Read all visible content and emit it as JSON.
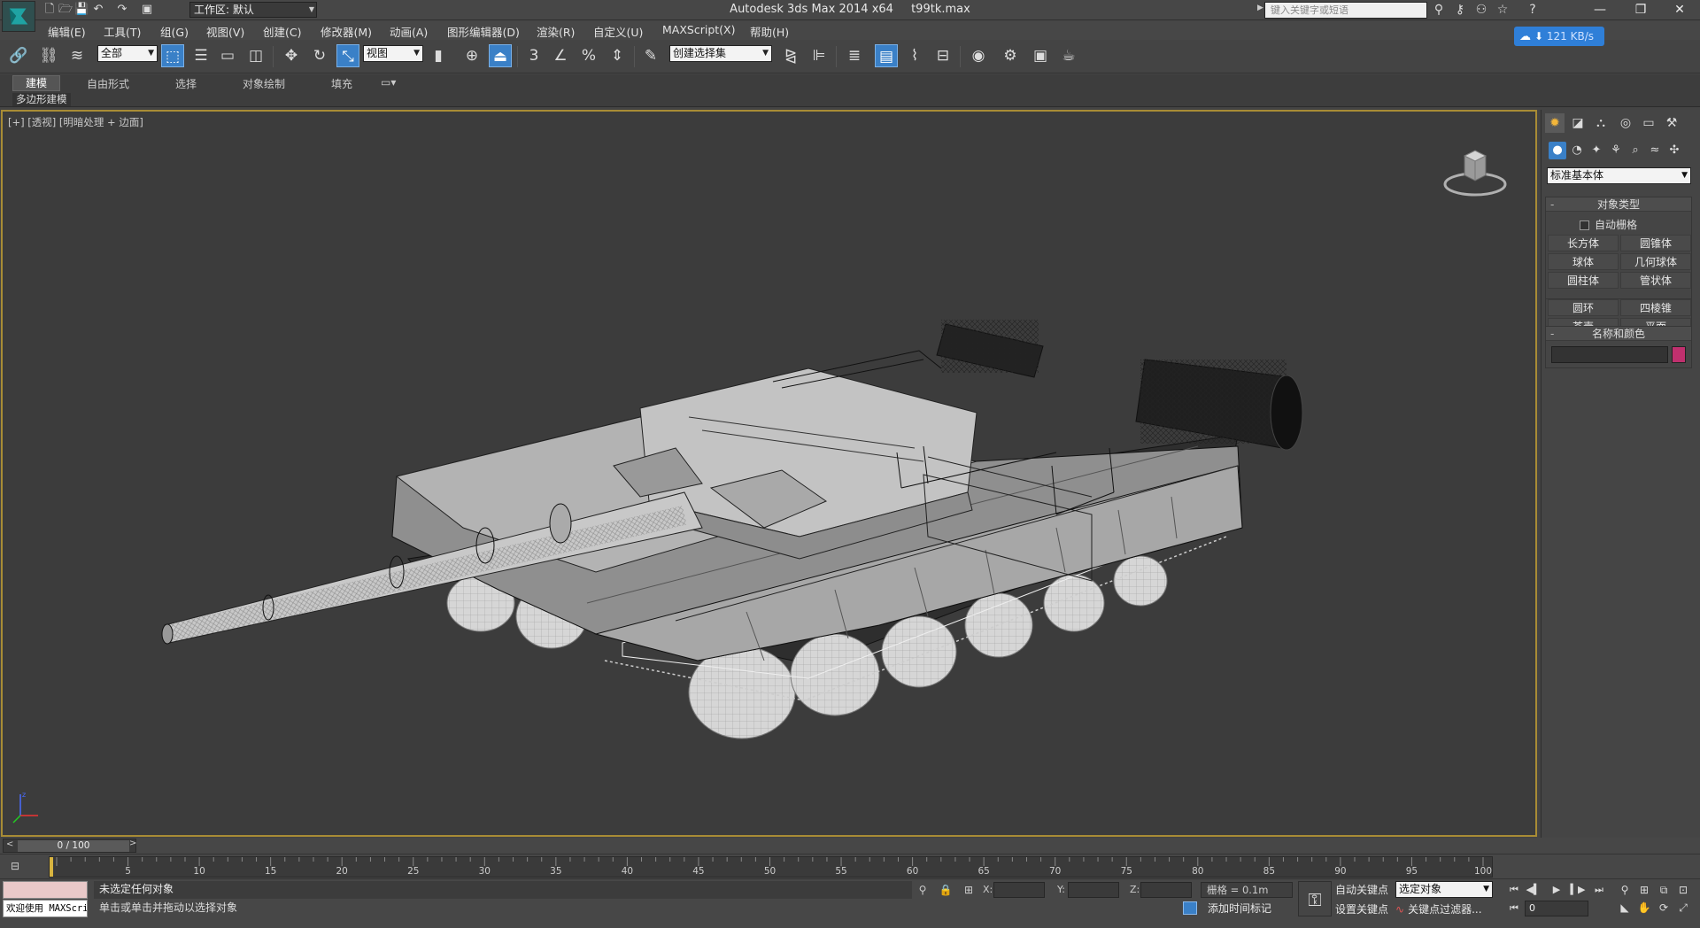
{
  "window": {
    "title_app": "Autodesk 3ds Max  2014 x64",
    "title_file": "t99tk.max",
    "workspace": "工作区: 默认",
    "search_placeholder": "键入关键字或短语",
    "minimize": "—",
    "restore": "❐",
    "close": "✕"
  },
  "menu": [
    "编辑(E)",
    "工具(T)",
    "组(G)",
    "视图(V)",
    "创建(C)",
    "修改器(M)",
    "动画(A)",
    "图形编辑器(D)",
    "渲染(R)",
    "自定义(U)",
    "MAXScript(X)",
    "帮助(H)"
  ],
  "network_badge": {
    "speed": "121 KB/s"
  },
  "toolbar": {
    "selection_filter": "全部",
    "ref_coord": "视图",
    "named_selection": "创建选择集",
    "snap_3": "3",
    "snap_percent": "%"
  },
  "ribbon": {
    "tabs": [
      "建模",
      "自由形式",
      "选择",
      "对象绘制",
      "填充"
    ],
    "active_tab": "建模",
    "sub_label": "多边形建模"
  },
  "viewport": {
    "label_parts": [
      "[+]",
      "[透视]",
      "[明暗处理 + 边面]"
    ]
  },
  "command_panel": {
    "category": "标准基本体",
    "object_type_title": "对象类型",
    "autogrid": "自动栅格",
    "object_buttons": [
      "长方体",
      "圆锥体",
      "球体",
      "几何球体",
      "圆柱体",
      "管状体",
      "圆环",
      "四棱锥",
      "茶壶",
      "平面"
    ],
    "name_color_title": "名称和颜色",
    "swatch_color": "#c0306e"
  },
  "timeline": {
    "frame_label": "0 / 100",
    "ticks": [
      5,
      10,
      15,
      20,
      25,
      30,
      35,
      40,
      45,
      50,
      55,
      60,
      65,
      70,
      75,
      80,
      85,
      90,
      95,
      100
    ]
  },
  "status": {
    "maxscript_welcome": "欢迎使用 MAXScri",
    "selection_status": "未选定任何对象",
    "prompt": "单击或单击并拖动以选择对象",
    "x_label": "X:",
    "y_label": "Y:",
    "z_label": "Z:",
    "grid": "栅格 = 0.1m",
    "add_time_tag": "添加时间标记",
    "auto_key": "自动关键点",
    "set_key": "设置关键点",
    "key_mode": "选定对象",
    "key_filters": "关键点过滤器...",
    "current_frame": "0"
  }
}
